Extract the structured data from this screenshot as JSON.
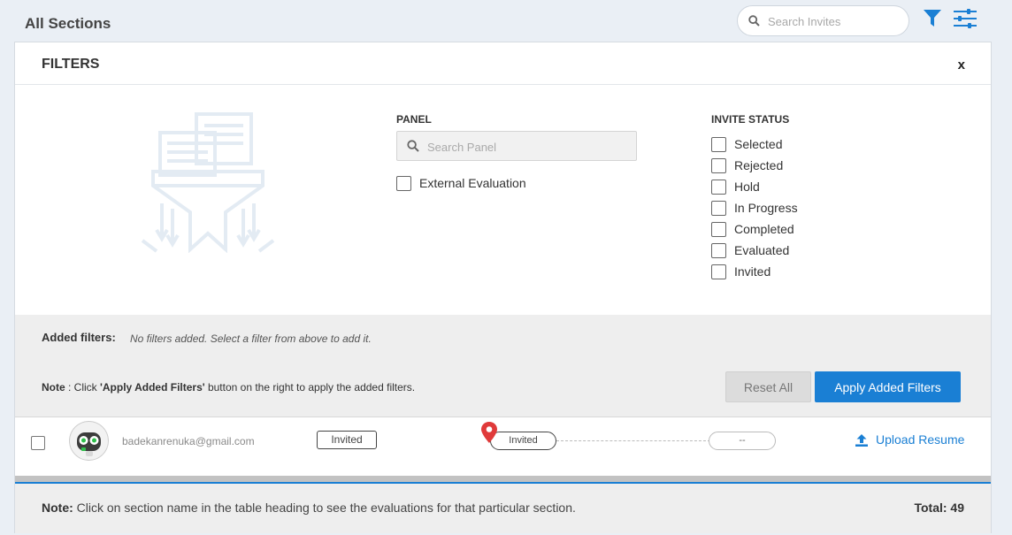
{
  "header": {
    "title": "All Sections",
    "search_placeholder": "Search Invites"
  },
  "filters": {
    "title": "FILTERS",
    "close_label": "x",
    "panel": {
      "label": "PANEL",
      "search_placeholder": "Search Panel",
      "options": [
        {
          "label": "External Evaluation",
          "checked": false
        }
      ]
    },
    "invite_status": {
      "label": "INVITE STATUS",
      "options": [
        {
          "label": "Selected",
          "checked": false
        },
        {
          "label": "Rejected",
          "checked": false
        },
        {
          "label": "Hold",
          "checked": false
        },
        {
          "label": "In Progress",
          "checked": false
        },
        {
          "label": "Completed",
          "checked": false
        },
        {
          "label": "Evaluated",
          "checked": false
        },
        {
          "label": "Invited",
          "checked": false
        }
      ]
    },
    "added": {
      "label": "Added filters:",
      "empty_text": "No filters added. Select a filter from above to add it."
    },
    "note": {
      "prefix": "Note",
      "text_1": " : Click ",
      "highlight": "'Apply Added Filters'",
      "text_2": " button on the right to apply the added filters."
    },
    "reset_label": "Reset All",
    "apply_label": "Apply Added Filters"
  },
  "rows": [
    {
      "email": "badekanrenuka@gmail.com",
      "status": "Invited",
      "progress_current": "Invited",
      "progress_next": "--",
      "upload_label": "Upload Resume"
    }
  ],
  "footer": {
    "note_label": "Note:",
    "note_text": " Click on section name in the table heading to see the evaluations for that particular section.",
    "total": "Total: 49"
  },
  "colors": {
    "accent": "#1a7fd4",
    "pin": "#e03a3a"
  },
  "icons": [
    "search-icon",
    "filter-icon",
    "settings-sliders-icon",
    "funnel-illustration",
    "robot-avatar",
    "location-pin-icon",
    "upload-icon"
  ]
}
